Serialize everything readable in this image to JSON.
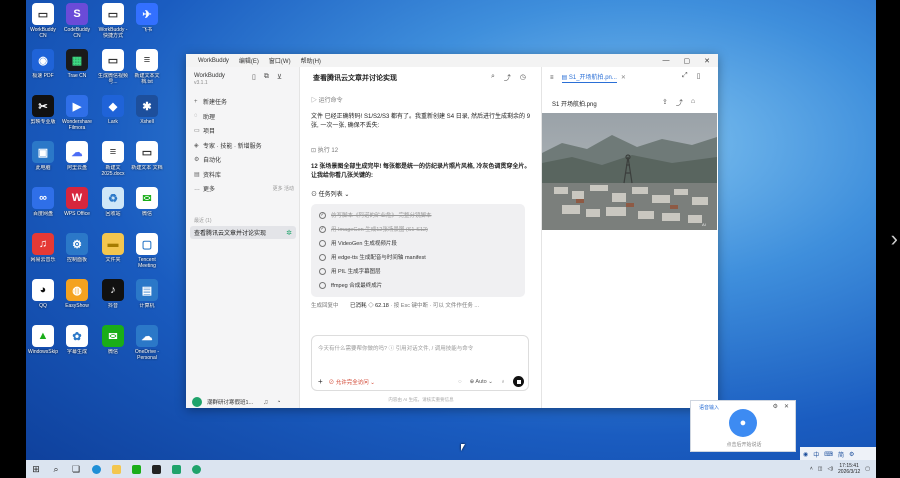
{
  "desktop_icons": [
    {
      "label": "WorkBuddy\nCN",
      "color": "#ffffff",
      "glyph": "▭",
      "fg": "#333"
    },
    {
      "label": "CodeBuddy\nCN",
      "color": "#6a4bd8",
      "glyph": "S",
      "fg": "#fff"
    },
    {
      "label": "WorkBuddy\n- 快捷方式",
      "color": "#ffffff",
      "glyph": "▭",
      "fg": "#333"
    },
    {
      "label": "飞书",
      "color": "#3370ff",
      "glyph": "✈",
      "fg": "#fff"
    },
    {
      "label": "极速\nPDF",
      "color": "#1f63d8",
      "glyph": "◉",
      "fg": "#fff"
    },
    {
      "label": "Trae CN",
      "color": "#1a1a1a",
      "glyph": "▦",
      "fg": "#3ddc84"
    },
    {
      "label": "生成微信视频\n号...",
      "color": "#ffffff",
      "glyph": "▭",
      "fg": "#333"
    },
    {
      "label": "新建文本文\n档.txt",
      "color": "#ffffff",
      "glyph": "≡",
      "fg": "#333"
    },
    {
      "label": "剪映专业版",
      "color": "#111111",
      "glyph": "✂",
      "fg": "#fff"
    },
    {
      "label": "Wondershare\nFilmora",
      "color": "#2f6fe8",
      "glyph": "▶",
      "fg": "#fff"
    },
    {
      "label": "Lark",
      "color": "#1f63d8",
      "glyph": "◆",
      "fg": "#fff"
    },
    {
      "label": "Xshell",
      "color": "#1d4f9c",
      "glyph": "✱",
      "fg": "#fff"
    },
    {
      "label": "此电脑",
      "color": "#2b78c8",
      "glyph": "▣",
      "fg": "#fff"
    },
    {
      "label": "阿里云盘",
      "color": "#ffffff",
      "glyph": "☁",
      "fg": "#4b6cf5"
    },
    {
      "label": "新建文\n2025.docx",
      "color": "#ffffff",
      "glyph": "≡",
      "fg": "#333"
    },
    {
      "label": "新建文本\n文档",
      "color": "#ffffff",
      "glyph": "▭",
      "fg": "#333"
    },
    {
      "label": "百度网盘",
      "color": "#2f6fe8",
      "glyph": "∞",
      "fg": "#fff"
    },
    {
      "label": "WPS Office",
      "color": "#d7263d",
      "glyph": "W",
      "fg": "#fff"
    },
    {
      "label": "回收站",
      "color": "#cfe6f7",
      "glyph": "♻",
      "fg": "#2b78c8"
    },
    {
      "label": "微信",
      "color": "#ffffff",
      "glyph": "✉",
      "fg": "#1aad19"
    },
    {
      "label": "网易云音乐",
      "color": "#e53935",
      "glyph": "♫",
      "fg": "#fff"
    },
    {
      "label": "控制面板",
      "color": "#2b78c8",
      "glyph": "⚙",
      "fg": "#fff"
    },
    {
      "label": "文件夹",
      "color": "#f3c64f",
      "glyph": "▬",
      "fg": "#a67c00"
    },
    {
      "label": "Tencent\nMeeting",
      "color": "#ffffff",
      "glyph": "▢",
      "fg": "#2b78c8"
    },
    {
      "label": "QQ",
      "color": "#ffffff",
      "glyph": "◕",
      "fg": "#111"
    },
    {
      "label": "EasyShow",
      "color": "#f4a21f",
      "glyph": "◍",
      "fg": "#fff"
    },
    {
      "label": "抖音",
      "color": "#111111",
      "glyph": "♪",
      "fg": "#fff"
    },
    {
      "label": "计算机",
      "color": "#2b78c8",
      "glyph": "▤",
      "fg": "#fff"
    },
    {
      "label": "WindowsSkip",
      "color": "#ffffff",
      "glyph": "▲",
      "fg": "#1aad19"
    },
    {
      "label": "字幕生成",
      "color": "#ffffff",
      "glyph": "✿",
      "fg": "#2b78c8"
    },
    {
      "label": "微信",
      "color": "#1aad19",
      "glyph": "✉",
      "fg": "#fff"
    },
    {
      "label": "OneDrive -\nPersonal",
      "color": "#2b78c8",
      "glyph": "☁",
      "fg": "#fff"
    }
  ],
  "app": {
    "title": "WorkBuddy",
    "menus": [
      "编辑(E)",
      "窗口(W)",
      "帮助(H)"
    ],
    "sidebar": {
      "brand": "WorkBuddy",
      "version": "v3.1.1",
      "items": [
        {
          "icon": "+",
          "label": "新建任务",
          "right": ""
        },
        {
          "icon": "◌",
          "label": "助理",
          "right": ""
        },
        {
          "icon": "▭",
          "label": "项目",
          "right": ""
        },
        {
          "icon": "◈",
          "label": "专家 · 技能 · 新增服务",
          "right": ""
        },
        {
          "icon": "⚙",
          "label": "自动化",
          "right": ""
        },
        {
          "icon": "▤",
          "label": "资料库",
          "right": ""
        },
        {
          "icon": "…",
          "label": "更多",
          "right": "更多 活动"
        }
      ],
      "section": "最近 (1)",
      "active_task": "查看腾讯云文章并讨论实现",
      "user_name": "潮群研讨寒假班1..."
    },
    "main": {
      "title": "查看腾讯云文章并讨论实现",
      "run_cmd": "运行命令",
      "msg1": "文件 已经正确转码! S1/S2/S3 都有了。我重新创建 S4 日录, 然后进行生成剩余的 9 张, 一次一张, 确保不丢失:",
      "run_step": "执行 12",
      "msg2": "12 张场景图全部生成完毕! 每张都是统一的仿纪录片照片风格, 冷灰色调贯穿全片。让我给你看几张关键的:",
      "task_list_label": "任务列表",
      "tasks": [
        {
          "label": "仿写脚本《阿诺的矿业危》 完整分镜脚本",
          "done": true
        },
        {
          "label": "用 ImageGen 生成12张场景图 (S1-S12)",
          "done": true
        },
        {
          "label": "用 VideoGen 生成视频片段",
          "done": false
        },
        {
          "label": "用 edge-tts 生成配音与时间轴 manifest",
          "done": false
        },
        {
          "label": "用 PIL 生成字幕图层",
          "done": false
        },
        {
          "label": "ffmpeg 合成最终成片",
          "done": false
        }
      ],
      "status_generating": "生成回复中",
      "status_used": "已消耗 ◇ 62.18",
      "status_hint": "· 按 Esc 键中断 · 可以 文件作任务 ...",
      "input_placeholder": "今天有什么需要帮你做的吗? ⓘ 引用对话文件, / 调用技能与命令",
      "perm_label": "允许完全访问",
      "mode_label": "Auto",
      "footer": "内容由 AI 生成，请核实重要信息"
    },
    "preview": {
      "tab_name": "S1_开场航拍.pn...",
      "file_name": "S1 开场航拍.png"
    }
  },
  "voice": {
    "label": "语音输入",
    "hint": "点击后开始说话"
  },
  "ime": [
    "中",
    "⌨",
    "简",
    "⚙"
  ],
  "taskbar": {
    "time": "17:15:41",
    "date": "2026/3/12"
  }
}
